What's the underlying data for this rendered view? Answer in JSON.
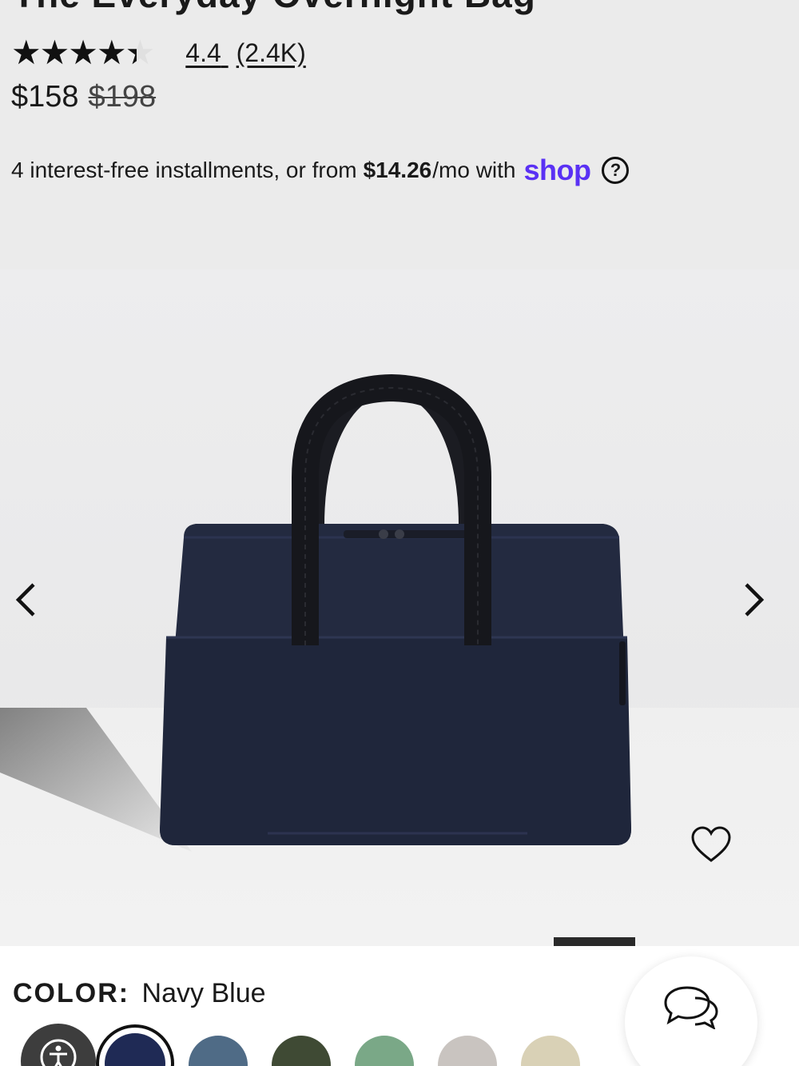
{
  "product": {
    "title_partial": "The Everyday Overnight Bag",
    "rating": {
      "stars_value": 4.4,
      "stars_max": 5,
      "value_text": "4.4",
      "count_text": "(2.4K)"
    },
    "price": {
      "current": "$158",
      "original": "$198"
    },
    "installments": {
      "prefix": "4 interest-free installments, or from",
      "amount": "$14.26",
      "suffix": "/mo with",
      "provider": "shop",
      "provider_color": "#5a31f4"
    }
  },
  "gallery": {
    "prev_icon": "chevron-left-icon",
    "next_icon": "chevron-right-icon",
    "favorite_icon": "heart-icon"
  },
  "color": {
    "label": "COLOR:",
    "selected": "Navy Blue",
    "swatches": [
      {
        "name": "Navy Blue",
        "hex": "#1f2a55",
        "selected": true
      },
      {
        "name": "Slate Blue",
        "hex": "#4f6b86",
        "selected": false
      },
      {
        "name": "Olive",
        "hex": "#3f4a34",
        "selected": false
      },
      {
        "name": "Sage Green",
        "hex": "#7aa887",
        "selected": false
      },
      {
        "name": "Grey",
        "hex": "#c9c4c0",
        "selected": false
      },
      {
        "name": "Sand",
        "hex": "#d9d1b6",
        "selected": false
      }
    ]
  },
  "widgets": {
    "accessibility_icon": "accessibility-icon",
    "chat_icon": "chat-bubbles-icon"
  }
}
